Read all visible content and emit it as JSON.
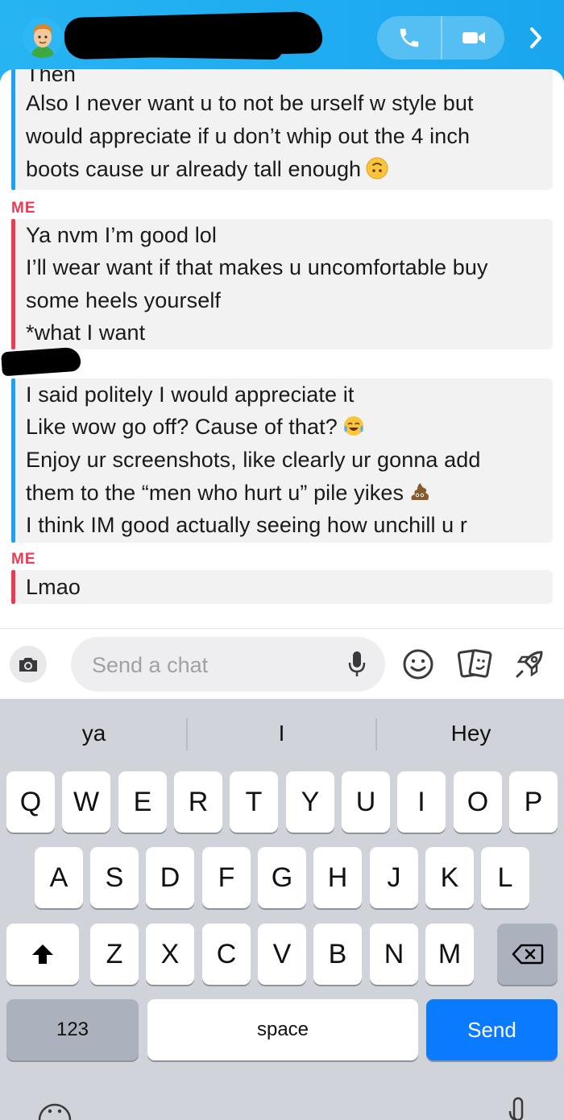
{
  "header": {
    "call_icon": "phone-icon",
    "video_icon": "video-camera-icon",
    "forward_icon": "chevron-right-icon",
    "accent_color": "#1ea8f1"
  },
  "messages": [
    {
      "sender": "",
      "side": "them",
      "lines": [
        "Then",
        "Also I never want u to not be urself w style but",
        "would appreciate if u don’t whip out the 4 inch",
        "boots cause ur already tall enough"
      ],
      "emoji": "upside-down-face"
    },
    {
      "sender": "ME",
      "side": "me",
      "lines": [
        "Ya nvm I’m good lol",
        "I’ll wear want if that makes u uncomfortable buy",
        "some heels yourself",
        "*what I want"
      ]
    },
    {
      "sender": "",
      "side": "them",
      "lines": [
        "I said politely I would appreciate it",
        "Like wow go off? Cause of that?",
        "Enjoy ur screenshots, like clearly ur gonna add",
        "them to the “men who hurt u” pile yikes",
        "I think IM good actually seeing how unchill u r"
      ]
    },
    {
      "sender": "ME",
      "side": "me",
      "lines": [
        "Lmao"
      ]
    }
  ],
  "input": {
    "placeholder": "Send a chat"
  },
  "keyboard": {
    "suggestions": [
      "ya",
      "I",
      "Hey"
    ],
    "row1": [
      "Q",
      "W",
      "E",
      "R",
      "T",
      "Y",
      "U",
      "I",
      "O",
      "P"
    ],
    "row2": [
      "A",
      "S",
      "D",
      "F",
      "G",
      "H",
      "J",
      "K",
      "L"
    ],
    "row3": [
      "Z",
      "X",
      "C",
      "V",
      "B",
      "N",
      "M"
    ],
    "numbers_label": "123",
    "space_label": "space",
    "send_label": "Send",
    "send_color": "#0a7aff"
  }
}
